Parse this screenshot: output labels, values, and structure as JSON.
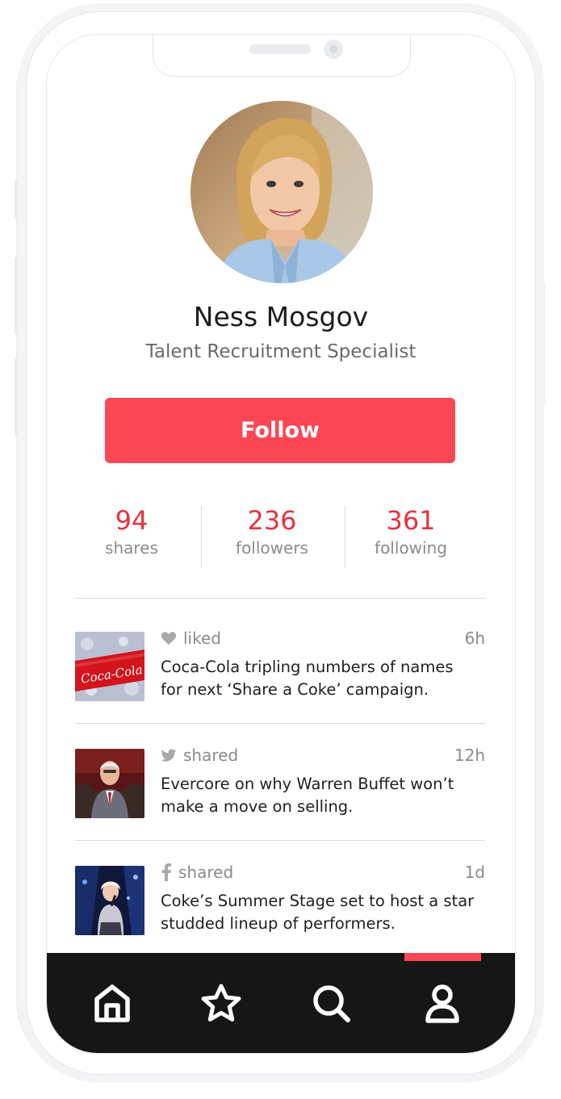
{
  "profile": {
    "name": "Ness Mosgov",
    "title": "Talent Recruitment Specialist",
    "follow_label": "Follow"
  },
  "stats": [
    {
      "value": "94",
      "label": "shares"
    },
    {
      "value": "236",
      "label": "followers"
    },
    {
      "value": "361",
      "label": "following"
    }
  ],
  "feed": [
    {
      "icon": "heart-icon",
      "action": "liked",
      "time": "6h",
      "text": "Coca-Cola tripling numbers of names for next ‘Share a Coke’ campaign.",
      "thumb_label": "Coca-Cola"
    },
    {
      "icon": "twitter-icon",
      "action": "shared",
      "time": "12h",
      "text": "Evercore on why Warren Buffet won’t make a move on selling."
    },
    {
      "icon": "facebook-icon",
      "action": "shared",
      "time": "1d",
      "text": "Coke’s Summer Stage set to host a star studded lineup of performers."
    }
  ],
  "tabbar": {
    "items": [
      "home-icon",
      "star-icon",
      "search-icon",
      "user-icon"
    ],
    "active": "user-icon"
  },
  "colors": {
    "accent": "#fb4755",
    "stat_number": "#e8323c",
    "tabbar_bg": "#161616"
  }
}
